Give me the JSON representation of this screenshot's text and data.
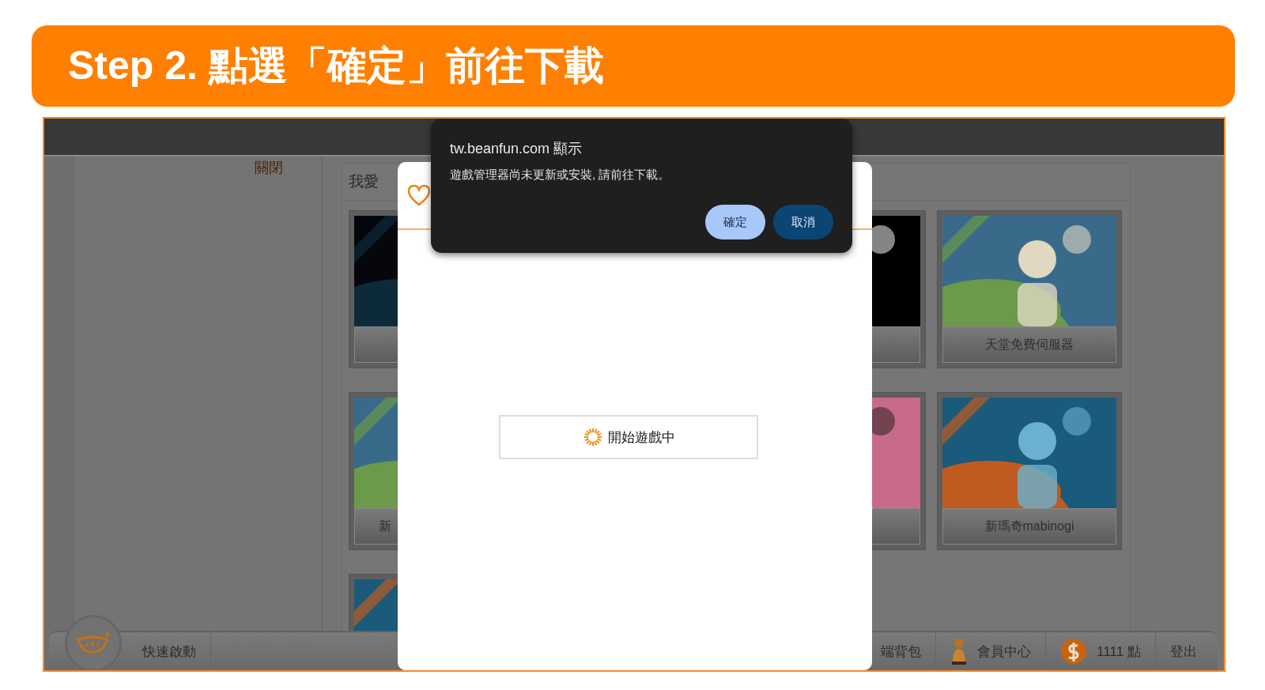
{
  "banner": {
    "title": "Step 2. 點選「確定」前往下載"
  },
  "page": {
    "close_link": "關閉",
    "section_title": "我愛",
    "games_left": [
      {
        "kind": "picture"
      },
      {
        "kind": "picture",
        "label": "新"
      },
      {
        "kind": "picture"
      }
    ],
    "games_right": [
      {
        "kind": "picture"
      },
      {
        "kind": "picture",
        "label": "天堂免費伺服器"
      },
      {
        "kind": "picture"
      },
      {
        "kind": "picture",
        "label": "新瑪奇mabinogi"
      }
    ],
    "bottom_bar": {
      "left": [
        {
          "kind": "text",
          "label": "快速啟動"
        }
      ],
      "right": [
        {
          "kind": "text",
          "label": "端背包"
        },
        {
          "kind": "person",
          "label": "會員中心"
        },
        {
          "kind": "coin",
          "label": "1111 點"
        },
        {
          "kind": "text",
          "label": "登出"
        }
      ]
    }
  },
  "modal": {
    "loading_text": "開始遊戲中"
  },
  "alert": {
    "title": "tw.beanfun.com 顯示",
    "message": "遊戲管理器尚未更新或安裝, 請前往下載。",
    "buttons": [
      {
        "label": "確定",
        "focused": true
      },
      {
        "label": "取消",
        "focused": false
      }
    ]
  }
}
